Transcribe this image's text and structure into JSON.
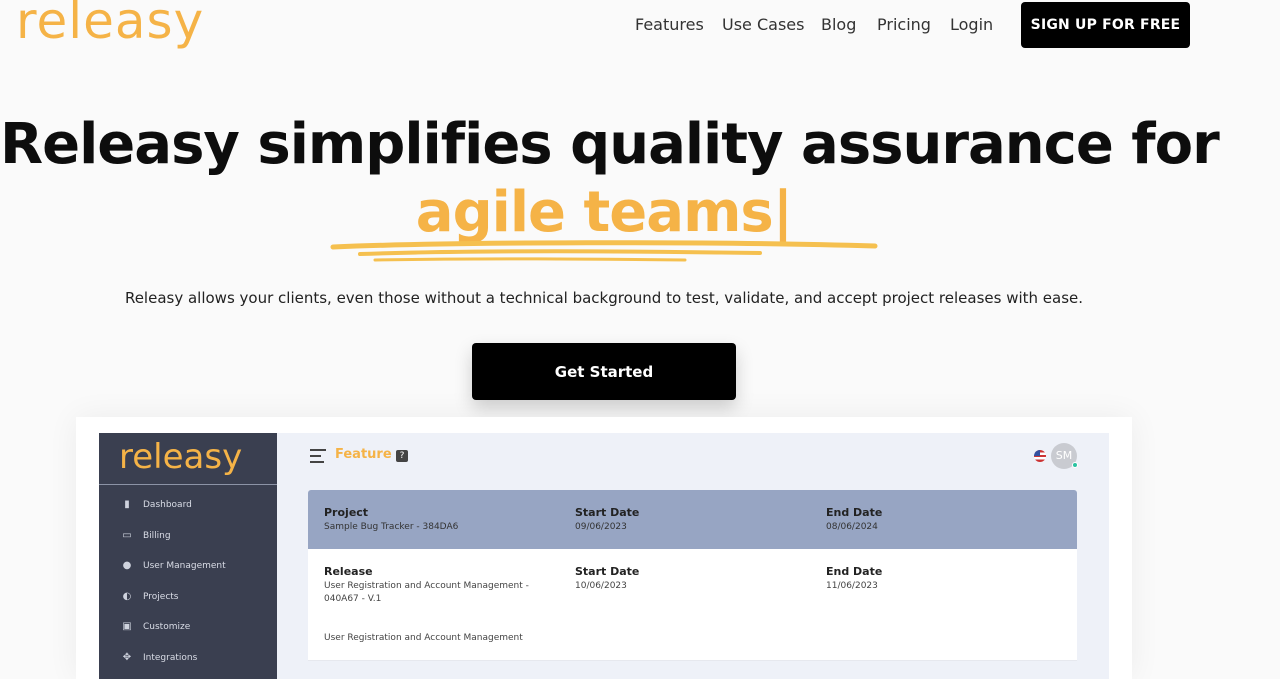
{
  "header": {
    "logo": "releasy",
    "nav": [
      "Features",
      "Use Cases",
      "Blog",
      "Pricing",
      "Login"
    ],
    "signup_label": "SIGN UP FOR FREE"
  },
  "hero": {
    "title": "Releasy simplifies quality assurance for",
    "accent": "agile teams|",
    "subtitle": "Releasy allows your clients, even those without a technical background to test, validate, and accept project releases with ease.",
    "cta_label": "Get Started"
  },
  "app_preview": {
    "logo": "releasy",
    "sidebar": [
      {
        "label": "Dashboard",
        "icon": "bar-chart-icon"
      },
      {
        "label": "Billing",
        "icon": "billing-icon"
      },
      {
        "label": "User Management",
        "icon": "users-icon"
      },
      {
        "label": "Projects",
        "icon": "projects-icon"
      },
      {
        "label": "Customize",
        "icon": "customize-icon"
      },
      {
        "label": "Integrations",
        "icon": "integrations-icon"
      }
    ],
    "page_title": "Feature",
    "help_glyph": "?",
    "avatar_initials": "SM",
    "project": {
      "label": "Project",
      "value": "Sample Bug Tracker - 384DA6",
      "start_label": "Start Date",
      "start_value": "09/06/2023",
      "end_label": "End Date",
      "end_value": "08/06/2024"
    },
    "release": {
      "label": "Release",
      "value_line1": "User Registration and Account Management -",
      "value_line2": "040A67 - V.1",
      "start_label": "Start Date",
      "start_value": "10/06/2023",
      "end_label": "End Date",
      "end_value": "11/06/2023",
      "description": "User Registration and Account Management"
    }
  },
  "colors": {
    "accent": "#f5b347",
    "sidebar": "#3a3f50",
    "project_header": "#97a5c3"
  }
}
